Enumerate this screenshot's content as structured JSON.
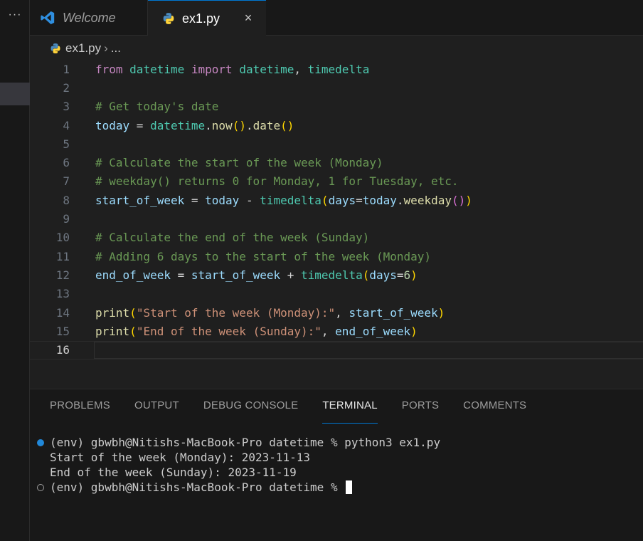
{
  "sidebar": {
    "more_label": "···"
  },
  "tabs": [
    {
      "label": "Welcome",
      "icon": "vscode-logo-icon",
      "active": false
    },
    {
      "label": "ex1.py",
      "icon": "python-file-icon",
      "active": true,
      "close": "×"
    }
  ],
  "breadcrumb": {
    "file": "ex1.py",
    "separator": "›",
    "rest": "..."
  },
  "editor": {
    "lines": [
      {
        "n": "1"
      },
      {
        "n": "2"
      },
      {
        "n": "3"
      },
      {
        "n": "4"
      },
      {
        "n": "5"
      },
      {
        "n": "6"
      },
      {
        "n": "7"
      },
      {
        "n": "8"
      },
      {
        "n": "9"
      },
      {
        "n": "10"
      },
      {
        "n": "11"
      },
      {
        "n": "12"
      },
      {
        "n": "13"
      },
      {
        "n": "14"
      },
      {
        "n": "15"
      },
      {
        "n": "16"
      }
    ],
    "code": {
      "l1": {
        "from": "from",
        "mod": "datetime",
        "imp": "import",
        "cls": "datetime",
        "comma": ", ",
        "cls2": "timedelta"
      },
      "l3": "# Get today's date",
      "l4": {
        "var": "today",
        "eq": " = ",
        "cls": "datetime",
        "dot": ".",
        "fn": "now",
        "p": "()",
        "dot2": ".",
        "fn2": "date",
        "p2": "()"
      },
      "l6": "# Calculate the start of the week (Monday)",
      "l7": "# weekday() returns 0 for Monday, 1 for Tuesday, etc.",
      "l8": {
        "var": "start_of_week",
        "eq": " = ",
        "var2": "today",
        "minus": " - ",
        "cls": "timedelta",
        "po": "(",
        "arg": "days",
        "as": "=",
        "var3": "today",
        "dot": ".",
        "fn": "weekday",
        "pi": "()",
        "pc": ")"
      },
      "l10": "# Calculate the end of the week (Sunday)",
      "l11": "# Adding 6 days to the start of the week (Monday)",
      "l12": {
        "var": "end_of_week",
        "eq": " = ",
        "var2": "start_of_week",
        "plus": " + ",
        "cls": "timedelta",
        "po": "(",
        "arg": "days",
        "as": "=",
        "num": "6",
        "pc": ")"
      },
      "l14": {
        "fn": "print",
        "po": "(",
        "str": "\"Start of the week (Monday):\"",
        "comma": ", ",
        "var": "start_of_week",
        "pc": ")"
      },
      "l15": {
        "fn": "print",
        "po": "(",
        "str": "\"End of the week (Sunday):\"",
        "comma": ", ",
        "var": "end_of_week",
        "pc": ")"
      }
    }
  },
  "panel": {
    "tabs": [
      "PROBLEMS",
      "OUTPUT",
      "DEBUG CONSOLE",
      "TERMINAL",
      "PORTS",
      "COMMENTS"
    ],
    "active_tab": "TERMINAL",
    "terminal": {
      "line1": "(env) gbwbh@Nitishs-MacBook-Pro datetime % python3 ex1.py",
      "line2": "Start of the week (Monday): 2023-11-13",
      "line3": "End of the week (Sunday): 2023-11-19",
      "line4": "(env) gbwbh@Nitishs-MacBook-Pro datetime % "
    }
  },
  "colors": {
    "accent": "#0078d4",
    "background": "#1f1f1f",
    "comment": "#6a9955",
    "keyword": "#c586c0",
    "class": "#4ec9b0"
  }
}
